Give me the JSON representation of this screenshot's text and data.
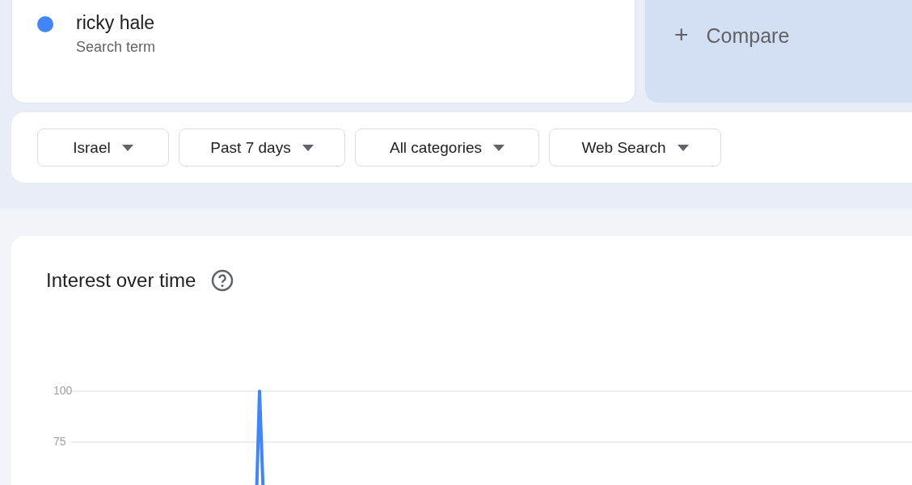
{
  "search_term": {
    "name": "ricky hale",
    "subtitle": "Search term",
    "color": "#4285f4"
  },
  "compare": {
    "icon": "+",
    "label": "Compare"
  },
  "filters": [
    {
      "label": "Israel"
    },
    {
      "label": "Past 7 days"
    },
    {
      "label": "All categories"
    },
    {
      "label": "Web Search"
    }
  ],
  "interest_over_time": {
    "title": "Interest over time",
    "y_axis_labels": [
      "100",
      "75"
    ]
  }
}
